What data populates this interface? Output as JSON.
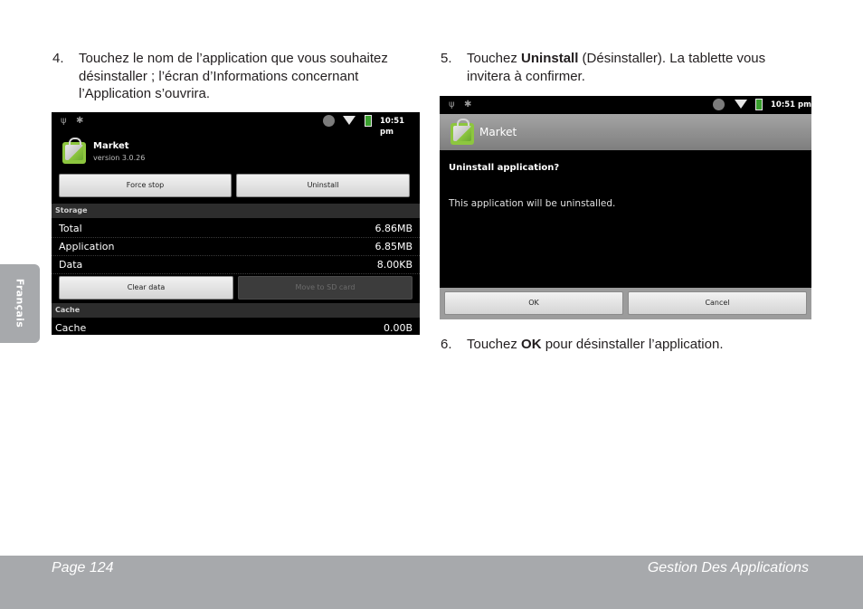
{
  "step4": {
    "num": "4.",
    "lines": [
      "Touchez le nom de l’application que vous souhaitez",
      "désinstaller ; l’écran d’Informations concernant",
      "l’Application s’ouvrira."
    ]
  },
  "step5": {
    "num": "5.",
    "line1_pre": "Touchez ",
    "line1_bold": "Uninstall",
    "line1_post": " (Désinstaller). La tablette vous",
    "line2": "invitera à confirmer."
  },
  "step6": {
    "num": "6.",
    "pre": "Touchez ",
    "bold": "OK",
    "post": " pour désinstaller l’application."
  },
  "side_tab": "Français",
  "footer": {
    "page": "Page 124",
    "section": "Gestion Des Applications"
  },
  "screen1": {
    "time": "10:51 pm",
    "app_name": "Market",
    "version": "version 3.0.26",
    "force_stop": "Force stop",
    "uninstall": "Uninstall",
    "storage_header": "Storage",
    "rows": [
      {
        "label": "Total",
        "value": "6.86MB"
      },
      {
        "label": "Application",
        "value": "6.85MB"
      },
      {
        "label": "Data",
        "value": "8.00KB"
      }
    ],
    "clear_data": "Clear data",
    "move_sd": "Move to SD card",
    "cache_header": "Cache",
    "cache_row": {
      "label": "Cache",
      "value": "0.00B"
    }
  },
  "screen2": {
    "time": "10:51 pm",
    "title": "Market",
    "dialog_title": "Uninstall application?",
    "message": "This application will be uninstalled.",
    "ok": "OK",
    "cancel": "Cancel"
  },
  "colors": {
    "footer": "#a7a9ac",
    "text": "#231f20",
    "titlebar": "#8e8e8e",
    "app_icon": "#8dc63f"
  }
}
